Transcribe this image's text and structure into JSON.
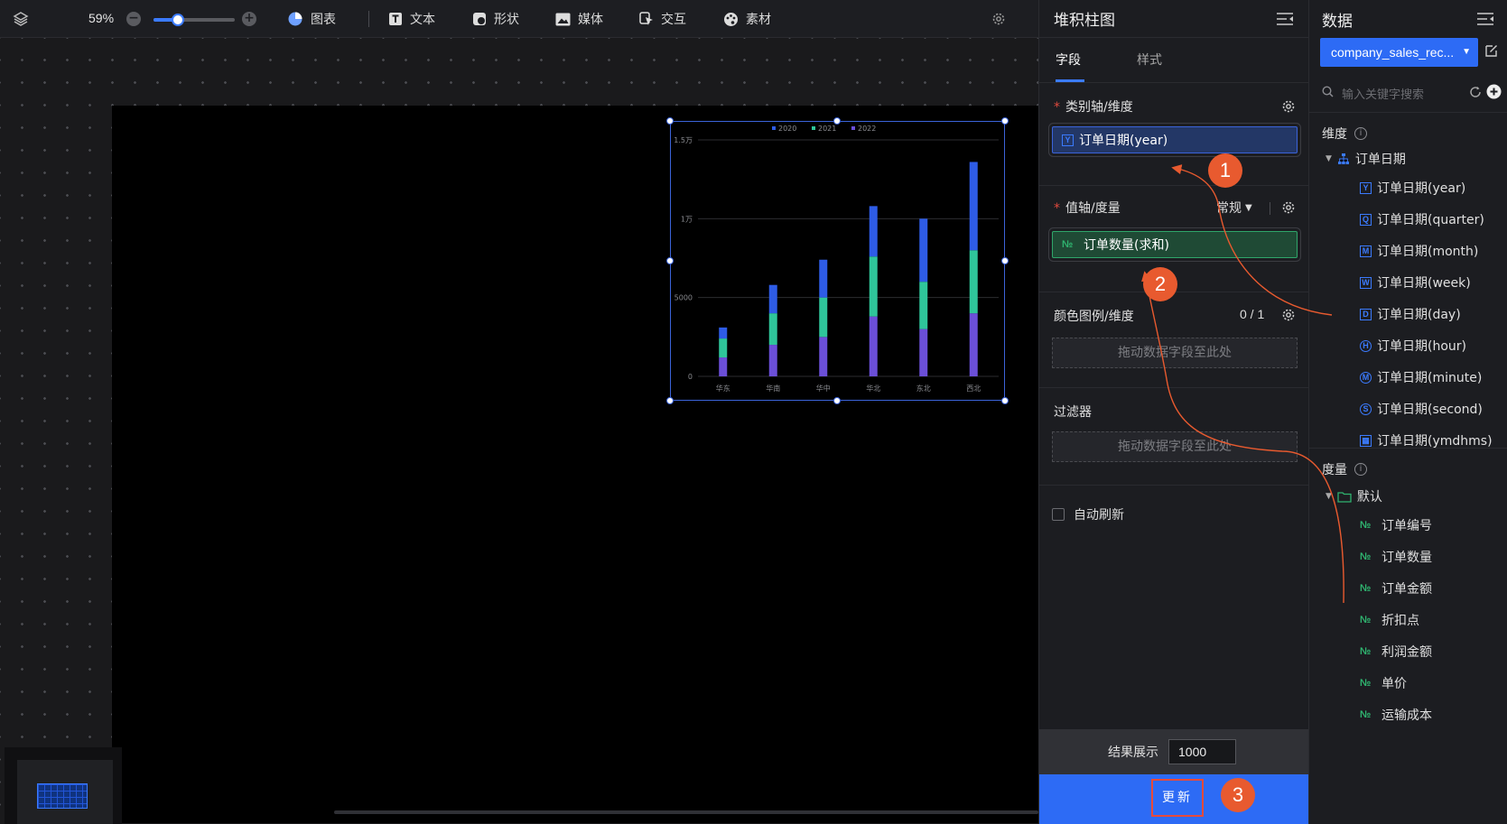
{
  "toolbar": {
    "zoom": "59%",
    "zoom_level": 0.3,
    "items": [
      {
        "label": "图表",
        "icon": "pie-chart-icon"
      },
      {
        "label": "文本",
        "icon": "text-icon"
      },
      {
        "label": "形状",
        "icon": "shape-icon"
      },
      {
        "label": "媒体",
        "icon": "image-icon"
      },
      {
        "label": "交互",
        "icon": "interaction-icon"
      },
      {
        "label": "素材",
        "icon": "palette-icon"
      }
    ]
  },
  "chart_data": {
    "type": "bar",
    "stacked": true,
    "categories": [
      "华东",
      "华南",
      "华中",
      "华北",
      "东北",
      "西北"
    ],
    "series": [
      {
        "name": "2020",
        "color": "#2e5ce6",
        "values": [
          700,
          1800,
          2400,
          3200,
          4000,
          5600
        ]
      },
      {
        "name": "2021",
        "color": "#2fc59a",
        "values": [
          1200,
          2000,
          2500,
          3800,
          3000,
          4000
        ]
      },
      {
        "name": "2022",
        "color": "#6b4fd8",
        "values": [
          1200,
          2000,
          2500,
          3800,
          3000,
          4000
        ]
      }
    ],
    "yticks": [
      "0",
      "5000",
      "1万",
      "1.5万"
    ],
    "ylim": [
      0,
      15000
    ],
    "legend_position": "top"
  },
  "props": {
    "title": "堆积柱图",
    "tabs": [
      "字段",
      "样式"
    ],
    "category_axis": {
      "title": "类别轴/维度",
      "field": "订单日期(year)",
      "field_icon": "Y"
    },
    "value_axis": {
      "title": "值轴/度量",
      "mode": "常规",
      "field": "订单数量(求和)",
      "field_icon": "№"
    },
    "color_legend": {
      "title": "颜色图例/维度",
      "count": "0 / 1",
      "placeholder": "拖动数据字段至此处"
    },
    "filter": {
      "title": "过滤器",
      "placeholder": "拖动数据字段至此处"
    },
    "auto_refresh": "自动刷新",
    "result_label": "结果展示",
    "result_value": "1000",
    "update_label": "更新",
    "badges": [
      "1",
      "2",
      "3"
    ]
  },
  "data": {
    "title": "数据",
    "dataset": "company_sales_rec...",
    "search_placeholder": "输入关键字搜索",
    "dimension_label": "维度",
    "dimension_group": "订单日期",
    "dimensions": [
      {
        "icon": "Y",
        "label": "订单日期(year)"
      },
      {
        "icon": "Q",
        "label": "订单日期(quarter)"
      },
      {
        "icon": "M",
        "label": "订单日期(month)"
      },
      {
        "icon": "W",
        "label": "订单日期(week)"
      },
      {
        "icon": "D",
        "label": "订单日期(day)"
      },
      {
        "icon": "H",
        "label": "订单日期(hour)"
      },
      {
        "icon": "M",
        "label": "订单日期(minute)"
      },
      {
        "icon": "S",
        "label": "订单日期(second)"
      },
      {
        "icon": "▦",
        "label": "订单日期(ymdhms)"
      }
    ],
    "measure_label": "度量",
    "measure_group": "默认",
    "measures": [
      "订单编号",
      "订单数量",
      "订单金额",
      "折扣点",
      "利润金额",
      "单价",
      "运输成本"
    ]
  }
}
